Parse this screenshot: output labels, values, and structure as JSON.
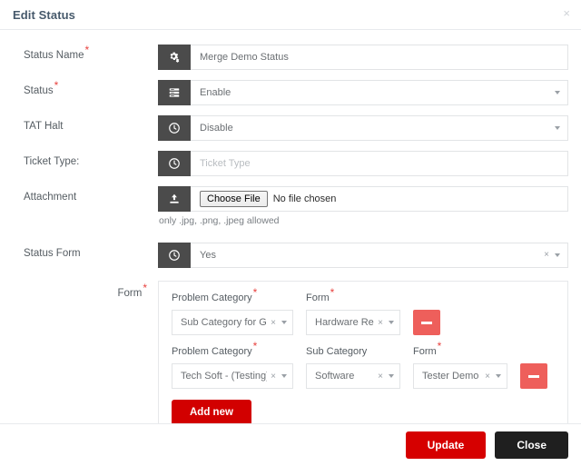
{
  "header": {
    "title": "Edit Status",
    "close_label": "×"
  },
  "fields": {
    "status_name": {
      "label": "Status Name",
      "required": true,
      "icon": "cogs-icon",
      "value": "Merge Demo Status"
    },
    "status": {
      "label": "Status",
      "required": true,
      "icon": "list-bars-icon",
      "value": "Enable"
    },
    "tat_halt": {
      "label": "TAT Halt",
      "required": false,
      "icon": "clock-icon",
      "value": "Disable"
    },
    "ticket_type": {
      "label": "Ticket Type:",
      "required": false,
      "icon": "clock-icon",
      "placeholder": "Ticket Type",
      "value": ""
    },
    "attachment": {
      "label": "Attachment",
      "required": false,
      "icon": "upload-icon",
      "choose_file_label": "Choose File",
      "file_name": "No file chosen",
      "help_text": "only .jpg, .png, .jpeg allowed"
    },
    "status_form": {
      "label": "Status Form",
      "required": false,
      "icon": "clock-icon",
      "value": "Yes",
      "clear_label": "×"
    }
  },
  "nested_form": {
    "label": "Form",
    "required": true,
    "rows": [
      {
        "fields": [
          {
            "label": "Problem Category",
            "required": true,
            "value": "Sub Category for Glob...",
            "clear_label": "×"
          },
          {
            "label": "Form",
            "required": true,
            "value": "Hardware Re...",
            "clear_label": "×"
          }
        ],
        "remove_label": "−"
      },
      {
        "fields": [
          {
            "label": "Problem Category",
            "required": true,
            "value": "Tech Soft - (Testing)",
            "clear_label": "×"
          },
          {
            "label": "Sub Category",
            "required": false,
            "value": "Software",
            "clear_label": "×"
          },
          {
            "label": "Form",
            "required": true,
            "value": "Tester Demo ...",
            "clear_label": "×"
          }
        ],
        "remove_label": "−"
      }
    ],
    "add_new_label": "Add new"
  },
  "footer": {
    "update_label": "Update",
    "close_label": "Close"
  },
  "colors": {
    "primary_red": "#d60000",
    "minus_red": "#ee5f5b",
    "title_color": "#46596b",
    "addon_dark": "#4b4b4b",
    "close_dark": "#1f1f1f",
    "required_star": "#e8423f"
  }
}
